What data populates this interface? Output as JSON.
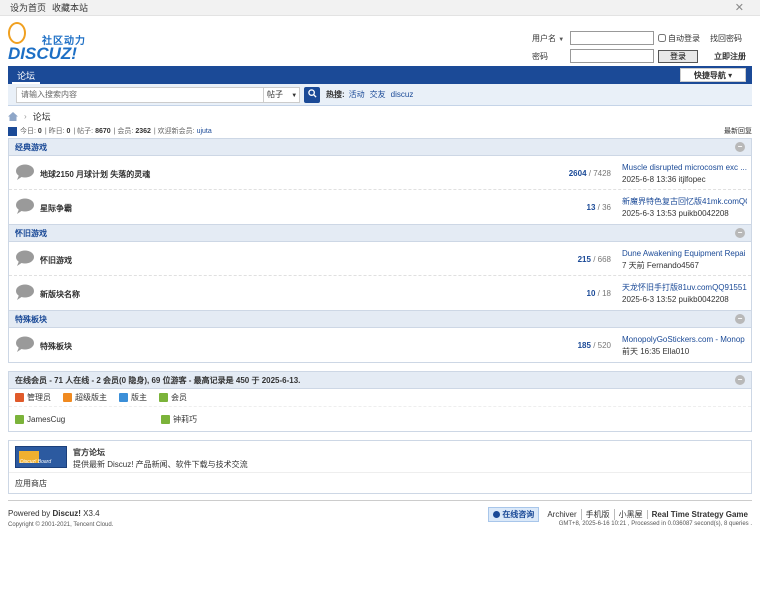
{
  "topbar": {
    "set_home": "设为首页",
    "bookmark": "收藏本站",
    "close_glyph": "✕"
  },
  "logo": {
    "slogan": "社区动力",
    "text": "DISCUZ!"
  },
  "login": {
    "username_label": "用户名",
    "password_label": "密码",
    "auto_login": "自动登录",
    "find_password": "找回密码",
    "login_button": "登录",
    "register": "立即注册"
  },
  "nav": {
    "tab": "论坛",
    "quick_nav": "快捷导航"
  },
  "search": {
    "placeholder": "请输入搜索内容",
    "type": "帖子",
    "hot_label": "热搜:",
    "hot_items": [
      "活动",
      "交友",
      "discuz"
    ]
  },
  "breadcrumb": {
    "current": "论坛"
  },
  "stats": {
    "today_label": "今日:",
    "today": "0",
    "yesterday_label": "昨日:",
    "yesterday": "0",
    "posts_label": "帖子:",
    "posts": "8670",
    "members_label": "会员:",
    "members": "2362",
    "newest_label": "欢迎新会员:",
    "newest": "ujuta",
    "latest_reply": "最新回复"
  },
  "sections": [
    {
      "title": "经典游戏",
      "forums": [
        {
          "name": "地球2150 月球计划 失落的灵魂",
          "threads": "2604",
          "posts": "7428",
          "last_title": "Muscle disrupted microcosm exc ...",
          "last_meta": "2025-6-8 13:36 itjlfopec"
        },
        {
          "name": "星际争霸",
          "threads": "13",
          "posts": "36",
          "last_title": "新魔界特色复古回忆版41mk.comQQ ...",
          "last_meta": "2025-6-3 13:53 puikb0042208"
        }
      ]
    },
    {
      "title": "怀旧游戏",
      "forums": [
        {
          "name": "怀旧游戏",
          "threads": "215",
          "posts": "668",
          "last_title": "Dune Awakening Equipment Repai ...",
          "last_meta": "7 天前 Fernando4567"
        },
        {
          "name": "新版块名称",
          "threads": "10",
          "posts": "18",
          "last_title": "天龙怀旧手打版81uv.comQQ915515 ...",
          "last_meta": "2025-6-3 13:52 puikb0042208"
        }
      ]
    },
    {
      "title": "特殊板块",
      "forums": [
        {
          "name": "特殊板块",
          "threads": "185",
          "posts": "520",
          "last_title": "MonopolyGoStickers.com - Monop ...",
          "last_meta": "前天 16:35 Ella010"
        }
      ]
    }
  ],
  "online": {
    "title": "在线会员 - 71 人在线 - 2 会员(0 隐身), 69 位游客 - 最高记录是 450 于 2025-6-13.",
    "legend": [
      {
        "label": "管理员",
        "color": "#e05a2a"
      },
      {
        "label": "超级版主",
        "color": "#f08a20"
      },
      {
        "label": "版主",
        "color": "#3b8fd8"
      },
      {
        "label": "会员",
        "color": "#7bb33a"
      }
    ],
    "users": [
      "JamesCug",
      "钟莉巧"
    ],
    "user_color": "#7bb33a"
  },
  "links": {
    "logo_text": "Discuz! Board",
    "title": "官方论坛",
    "desc": "提供最新 Discuz! 产品新闻、软件下载与技术交流",
    "app_store": "应用商店"
  },
  "footer": {
    "powered_prefix": "Powered by",
    "powered_name": "Discuz!",
    "version": "X3.4",
    "copyright": "Copyright © 2001-2021, Tencent Cloud.",
    "consult": "在线咨询",
    "links": [
      "Archiver",
      "手机版",
      "小黑屋",
      "Real Time Strategy Game"
    ],
    "gmt": "GMT+8, 2025-6-16 10:21 , Processed in 0.036087 second(s), 8 queries ."
  }
}
